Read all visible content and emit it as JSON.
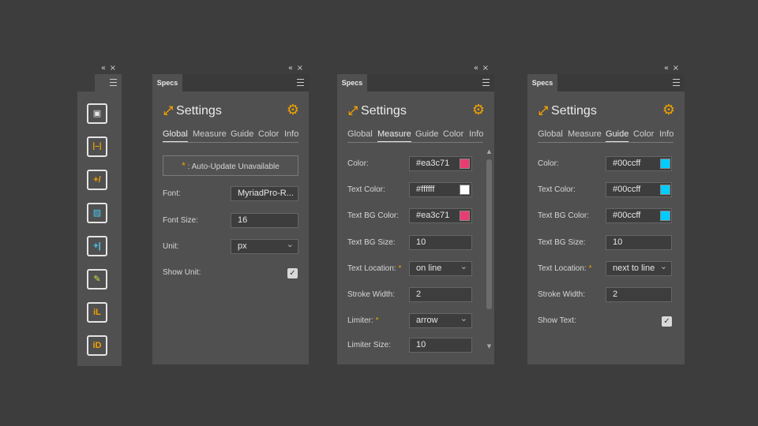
{
  "colors": {
    "accent": "#f0a100",
    "panel_bg": "#505050",
    "app_bg": "#3d3d3d"
  },
  "window_controls": {
    "collapse": "«",
    "close": "×"
  },
  "toolbar": {
    "tools": [
      {
        "icon": "frame-icon",
        "glyph": "▣"
      },
      {
        "icon": "measure-width-icon",
        "glyph": "|–|"
      },
      {
        "icon": "add-note-icon",
        "glyph": "+/"
      },
      {
        "icon": "bounding-box-icon",
        "glyph": "▨"
      },
      {
        "icon": "add-guide-icon",
        "glyph": "+|"
      },
      {
        "icon": "color-picker-icon",
        "glyph": "✎"
      },
      {
        "icon": "info-layer-icon",
        "glyph": "iL"
      },
      {
        "icon": "info-detail-icon",
        "glyph": "iD"
      }
    ]
  },
  "panels": [
    {
      "tab": "Specs",
      "title": "Settings",
      "nav": [
        "Global",
        "Measure",
        "Guide",
        "Color",
        "Info"
      ],
      "active_nav": "Global",
      "auto_update": {
        "star": "*",
        "label": ": Auto-Update Unavailable"
      },
      "fields": [
        {
          "label": "Font:",
          "value": "MyriadPro-R..."
        },
        {
          "label": "Font Size:",
          "value": "16"
        },
        {
          "label": "Unit:",
          "value": "px"
        },
        {
          "label": "Show Unit:",
          "checked": true
        }
      ]
    },
    {
      "tab": "Specs",
      "title": "Settings",
      "nav": [
        "Global",
        "Measure",
        "Guide",
        "Color",
        "Info"
      ],
      "active_nav": "Measure",
      "fields": [
        {
          "label": "Color:",
          "value": "#ea3c71",
          "swatch": "#ea3c71"
        },
        {
          "label": "Text Color:",
          "value": "#ffffff",
          "swatch": "#ffffff"
        },
        {
          "label": "Text BG Color:",
          "value": "#ea3c71",
          "swatch": "#ea3c71"
        },
        {
          "label": "Text BG Size:",
          "value": "10"
        },
        {
          "label": "Text Location:",
          "star": "*",
          "value": "on line"
        },
        {
          "label": "Stroke Width:",
          "value": "2"
        },
        {
          "label": "Limiter:",
          "star": "*",
          "value": "arrow"
        },
        {
          "label": "Limiter Size:",
          "value": "10"
        }
      ]
    },
    {
      "tab": "Specs",
      "title": "Settings",
      "nav": [
        "Global",
        "Measure",
        "Guide",
        "Color",
        "Info"
      ],
      "active_nav": "Guide",
      "fields": [
        {
          "label": "Color:",
          "value": "#00ccff",
          "swatch": "#00ccff"
        },
        {
          "label": "Text Color:",
          "value": "#00ccff",
          "swatch": "#00ccff"
        },
        {
          "label": "Text BG Color:",
          "value": "#00ccff",
          "swatch": "#00ccff"
        },
        {
          "label": "Text BG Size:",
          "value": "10"
        },
        {
          "label": "Text Location:",
          "star": "*",
          "value": "next to line"
        },
        {
          "label": "Stroke Width:",
          "value": "2"
        },
        {
          "label": "Show Text:",
          "checked": true
        }
      ]
    }
  ]
}
